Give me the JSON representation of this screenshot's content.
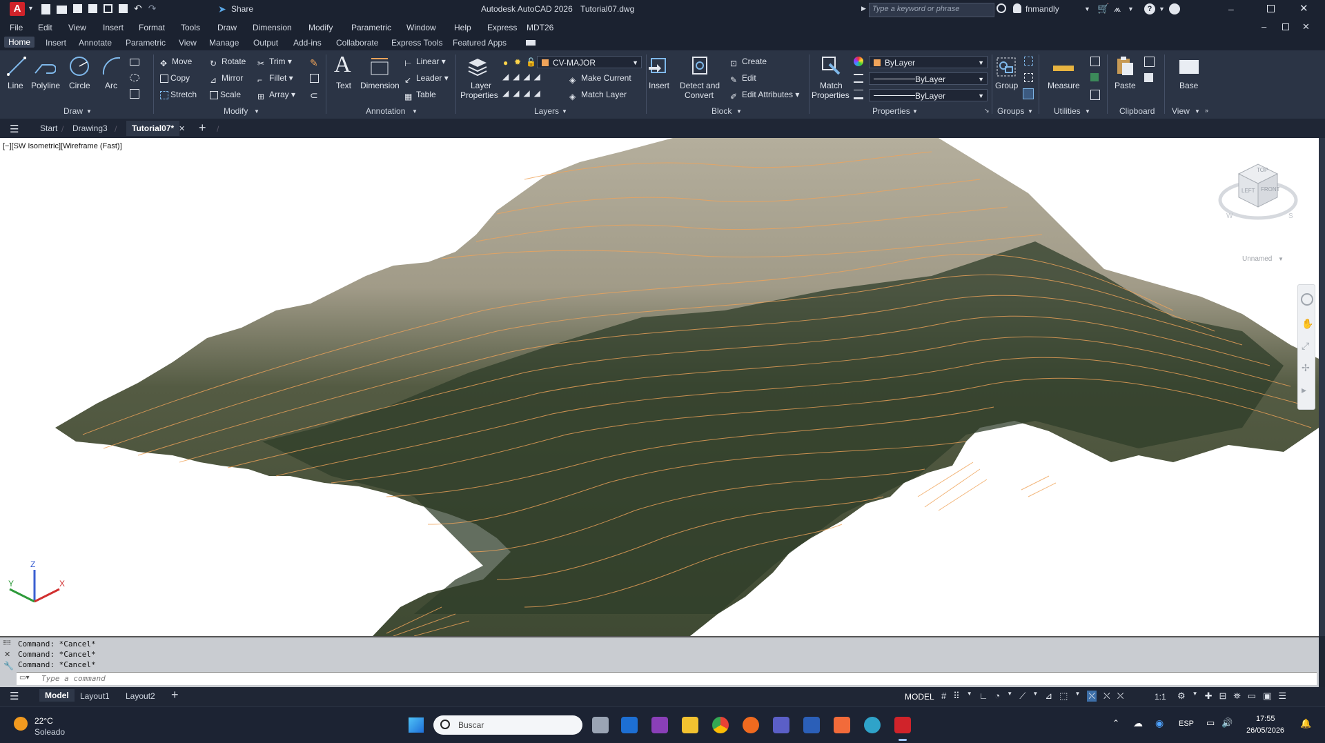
{
  "app": {
    "title": "Autodesk AutoCAD 2026",
    "filename": "Tutorial07.dwg",
    "share_label": "Share",
    "search_placeholder": "Type a keyword or phrase",
    "user": "fnmandly"
  },
  "menu": [
    "File",
    "Edit",
    "View",
    "Insert",
    "Format",
    "Tools",
    "Draw",
    "Dimension",
    "Modify",
    "Parametric",
    "Window",
    "Help",
    "Express",
    "MDT26"
  ],
  "ribbon_tabs": [
    "Home",
    "Insert",
    "Annotate",
    "Parametric",
    "View",
    "Manage",
    "Output",
    "Add-ins",
    "Collaborate",
    "Express Tools",
    "Featured Apps"
  ],
  "draw": {
    "line": "Line",
    "polyline": "Polyline",
    "circle": "Circle",
    "arc": "Arc",
    "panel": "Draw"
  },
  "modify": {
    "move": "Move",
    "copy": "Copy",
    "stretch": "Stretch",
    "rotate": "Rotate",
    "mirror": "Mirror",
    "scale": "Scale",
    "trim": "Trim",
    "fillet": "Fillet",
    "array": "Array",
    "panel": "Modify"
  },
  "annotation": {
    "text": "Text",
    "dimension": "Dimension",
    "linear": "Linear",
    "leader": "Leader",
    "table": "Table",
    "panel": "Annotation"
  },
  "layers": {
    "layer_properties_1": "Layer",
    "layer_properties_2": "Properties",
    "current_layer": "CV-MAJOR",
    "make_current": "Make Current",
    "match_layer": "Match Layer",
    "panel": "Layers"
  },
  "block": {
    "insert": "Insert",
    "detect_1": "Detect and",
    "detect_2": "Convert",
    "create": "Create",
    "edit": "Edit",
    "edit_attributes": "Edit Attributes",
    "panel": "Block"
  },
  "properties": {
    "match_1": "Match",
    "match_2": "Properties",
    "color": "ByLayer",
    "linetype": "ByLayer",
    "lineweight": "ByLayer",
    "panel": "Properties"
  },
  "groups": {
    "group": "Group",
    "panel": "Groups"
  },
  "utilities": {
    "measure": "Measure",
    "panel": "Utilities"
  },
  "clipboard": {
    "paste": "Paste",
    "panel": "Clipboard"
  },
  "view_panel": {
    "base": "Base",
    "panel": "View"
  },
  "file_tabs": [
    "Start",
    "Drawing3",
    "Tutorial07*"
  ],
  "viewport_label": "[−][SW Isometric][Wireframe (Fast)]",
  "viewcube": {
    "top": "TOP",
    "left": "LEFT",
    "front": "FRONT",
    "w": "W",
    "s": "S",
    "named": "Unnamed"
  },
  "command_history": [
    "Command: *Cancel*",
    "Command: *Cancel*",
    "Command: *Cancel*"
  ],
  "command_placeholder": "Type a command",
  "layout_tabs": [
    "Model",
    "Layout1",
    "Layout2"
  ],
  "status": {
    "model": "MODEL",
    "scale": "1:1"
  },
  "taskbar": {
    "temperature": "22°C",
    "weather": "Soleado",
    "search": "Buscar",
    "lang": "ESP",
    "time": "17:55",
    "date": "26/05/2026"
  },
  "colors": {
    "contour": "#f0a45a",
    "accent": "#d0232a",
    "ribbon": "#2b3445",
    "titlebar": "#1b2230"
  }
}
